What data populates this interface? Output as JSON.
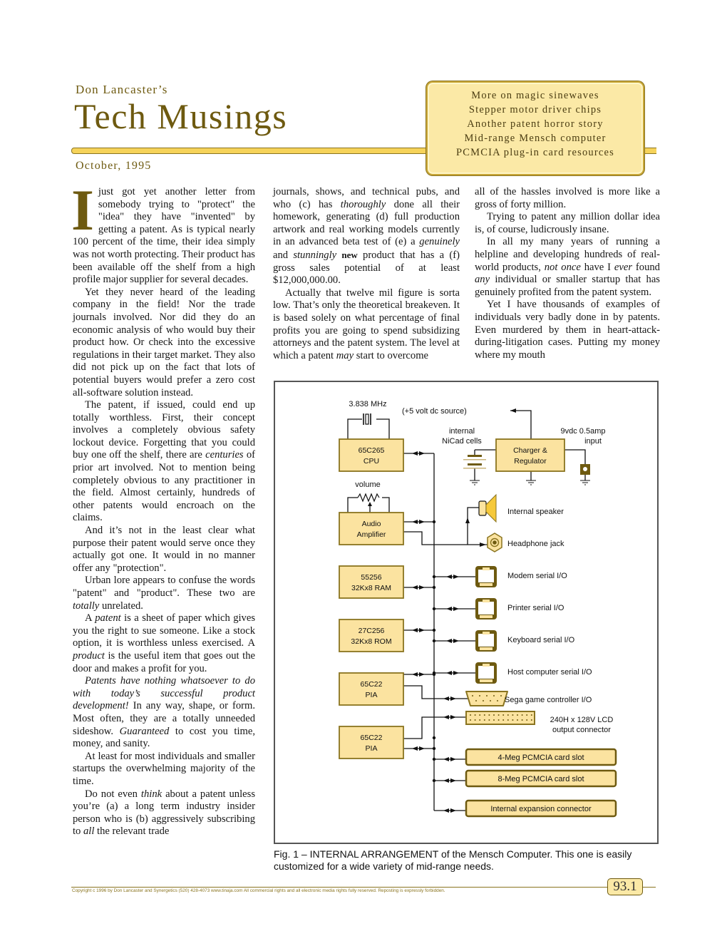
{
  "header": {
    "author": "Don Lancaster’s",
    "title": "Tech Musings",
    "date": "October, 1995"
  },
  "toc": [
    "More on magic sinewaves",
    "Stepper motor driver chips",
    "Another patent horror story",
    "Mid-range Mensch computer",
    "PCMCIA plug-in card resources"
  ],
  "article": {
    "dropcap": "I",
    "col1": {
      "p1": "just got yet another letter from somebody trying to \"protect\" the \"idea\" they have \"invented\" by getting a patent. As is typical nearly 100 percent of the time, their idea simply was not worth protecting. Their product has been available off the shelf from a high profile major supplier for several decades.",
      "p2": "Yet they never heard of the leading company in the field! Nor the trade journals involved. Nor did they do an economic analysis of who would buy their product how. Or check into the excessive regulations in their target market. They also did not pick up on the fact that lots of potential buyers would prefer a zero cost all-software solution instead.",
      "p3a": "The patent, if issued, could end up totally worthless. First, their concept involves a completely obvious safety lockout device. Forgetting that you could buy one off the shelf, there are ",
      "p3em": "centuries",
      "p3b": " of prior art involved. Not to mention being completely obvious to any practitioner in the field. Almost certainly, hundreds of other patents would encroach on the claims.",
      "p4": "And it’s not in the least clear what purpose their patent would serve once they actually got one. It would in no manner offer any \"protection\".",
      "p5a": "Urban lore appears to confuse the words \"patent\" and \"product\". These two are ",
      "p5em": "totally",
      "p5b": " unrelated.",
      "p6a": "A ",
      "p6em1": "patent",
      "p6b": " is a sheet of paper which gives you the right to sue someone. Like a stock option, it is worthless unless exercised. A ",
      "p6em2": "product",
      "p6c": " is the useful item that goes out the door and makes a profit for you.",
      "p7em": "Patents have nothing whatsoever to do with today’s successful product development!",
      "p7a": " In any way, shape, or form. Most often, they are a totally unneeded sideshow. ",
      "p7em2": "Guaranteed",
      "p7b": " to cost you time, money, and sanity.",
      "p8": "At least for most individuals and smaller startups the overwhelming majority of the time.",
      "p9a": "Do not even ",
      "p9em": "think",
      "p9b": " about a patent unless you’re (a) a long term industry insider person who is (b) aggressively subscribing to ",
      "p9em2": "all",
      "p9c": " the relevant trade"
    },
    "col2": {
      "p1a": "journals, shows, and technical pubs, and who (c) has ",
      "p1em1": "thoroughly",
      "p1b": " done all their homework, generating (d) full production artwork and real working models currently in an advanced beta test of (e) a ",
      "p1em2": "genuinely",
      "p1c": " and ",
      "p1em3": "stunningly",
      "p1bold": "new",
      "p1d": " product that has a (f) gross sales potential of at least $12,000,000.00.",
      "p2a": "Actually that twelve mil figure is sorta low. That’s only the theoretical breakeven. It is based solely on what percentage of final profits you are going to spend subsidizing attorneys and the patent system. The level at which a patent ",
      "p2em": "may",
      "p2b": " start to overcome"
    },
    "col3": {
      "p1": "all of the hassles involved is more like a gross of forty million.",
      "p2": "Trying to patent any million dollar idea is, of course, ludicrously insane.",
      "p3a": "In all my many years of running a helpline and developing hundreds of real-world products, ",
      "p3em1": "not once",
      "p3b": " have I ",
      "p3em2": "ever",
      "p3c": " found ",
      "p3em3": "any",
      "p3d": " individual or smaller startup that has genuinely profited from the patent system.",
      "p4": "Yet I have thousands of examples of individuals very badly done in by patents. Even murdered by them in heart-attack-during-litigation cases. Putting my money where my mouth"
    }
  },
  "figure": {
    "crystal_label": "3.838 MHz",
    "power_label": "(+5 volt dc source)",
    "nicad_label_1": "internal",
    "nicad_label_2": "NiCad cells",
    "input_label_1": "9vdc 0.5amp",
    "input_label_2": "input",
    "volume_label": "volume",
    "blocks": [
      {
        "line1": "65C265",
        "line2": "CPU"
      },
      {
        "line1": "Charger &",
        "line2": "Regulator"
      },
      {
        "line1": "Audio",
        "line2": "Amplifier"
      },
      {
        "line1": "55256",
        "line2": "32Kx8 RAM"
      },
      {
        "line1": "27C256",
        "line2": "32Kx8 ROM"
      },
      {
        "line1": "65C22",
        "line2": "PIA"
      },
      {
        "line1": "65C22",
        "line2": "PIA"
      }
    ],
    "io_labels": {
      "speaker": "Internal speaker",
      "headphone": "Headphone jack",
      "modem": "Modem serial I/O",
      "printer": "Printer serial I/O",
      "keyboard": "Keyboard serial I/O",
      "host": "Host computer serial I/O",
      "sega": "Sega game controller I/O",
      "lcd_1": "240H x 128V LCD",
      "lcd_2": "output connector"
    },
    "slots": [
      "4-Meg PCMCIA card slot",
      "8-Meg PCMCIA card slot",
      "Internal expansion connector"
    ],
    "caption": "Fig. 1 – INTERNAL ARRANGEMENT of the Mensch Computer. This one is easily customized for a wide variety of mid-range needs."
  },
  "footer": {
    "copyright": "Copyright c 1996 by Don Lancaster and Synergetics  (520) 428-4073  www.tinaja.com  All commercial rights and all electronic media rights fully reserved. Reposting is expressly forbidden.",
    "page_number": "93.1"
  },
  "colors": {
    "brand_brown": "#6e5a10",
    "gold": "#f6d35a",
    "block_fill": "#fbe3a0",
    "block_border": "#8a7420"
  }
}
